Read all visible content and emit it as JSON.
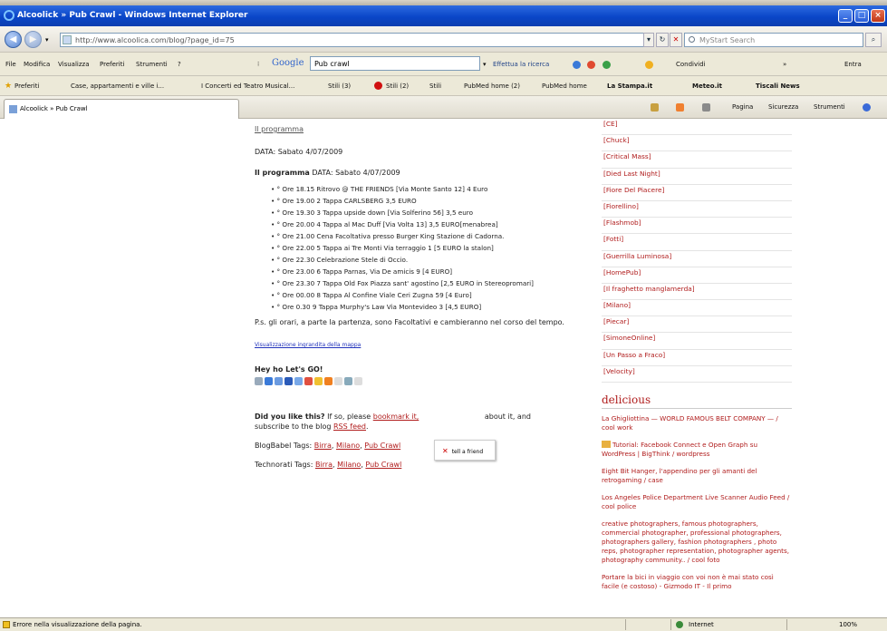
{
  "window": {
    "title": "Alcoolick » Pub Crawl - Windows Internet Explorer"
  },
  "nav": {
    "address": "http://www.alcoolica.com/blog/?page_id=75",
    "search_placeholder": "MyStart Search"
  },
  "menu": {
    "items": [
      "File",
      "Modifica",
      "Visualizza",
      "Preferiti",
      "Strumenti",
      "?"
    ],
    "google_query": "Pub crawl",
    "toolbar_items": [
      "Effettua la ricerca",
      "Condividi",
      "Entra"
    ]
  },
  "favorites": {
    "label": "Preferiti",
    "items": [
      "Case, appartamenti e ville i...",
      "I Concerti ed Teatro Musical...",
      "Stili (3)",
      "Stili (2)",
      "Stili",
      "PubMed home (2)",
      "PubMed home",
      "La Stampa.it",
      "Meteo.it",
      "Tiscali News"
    ]
  },
  "tab": {
    "title": "Alcoolick » Pub Crawl",
    "tools": [
      "Pagina",
      "Sicurezza",
      "Strumenti"
    ]
  },
  "main": {
    "section_title": "Il programma",
    "date_line": "DATA: Sabato 4/07/2009",
    "program_heading": "Il programma",
    "program_date": "DATA: Sabato 4/07/2009",
    "items": [
      "° Ore 18.15 Ritrovo @ THE FRIENDS [Via Monte Santo 12] 4 Euro",
      "° Ore 19.00 2 Tappa CARLSBERG 3,5 EURO",
      "° Ore 19.30 3 Tappa upside down [Via Solferino 56] 3,5 euro",
      "° Ore 20.00 4 Tappa al Mac Duff [Via Volta 13] 3,5 EURO[menabrea]",
      "° Ore 21.00 Cena Facoltativa presso Burger King Stazione di Cadorna.",
      "° Ore 22.00 5 Tappa ai Tre Monti Via terraggio 1 [5 EURO la stalon]",
      "° Ore 22.30 Celebrazione Stele di Occio.",
      "° Ore 23.00 6 Tappa Parnas, Via De amicis 9 [4 EURO]",
      "° Ore 23.30 7 Tappa Old Fox Piazza sant' agostino [2,5 EURO in Stereopromari]",
      "° Ore 00.00 8 Tappa Al Confine Viale Ceri Zugna 59 [4 Euro]",
      "° Ore 0.30 9 Tappa Murphy's Law Via Montevideo 3 [4,5 EURO]"
    ],
    "note": "P.s. gli orari, a parte la partenza, sono Facoltativi e cambieranno nel corso del tempo.",
    "map_link": "Visualizzazione ingrandita della mappa",
    "share_title": "Hey ho Let's GO!",
    "like_prefix": "Did you like this?",
    "like_mid1": " If so, please ",
    "bookmark_link": "bookmark it,",
    "tell_friend": "tell a friend",
    "like_mid2": " about it, and subscribe to the blog ",
    "rss_link": "RSS feed",
    "like_end": ".",
    "bloglines_label": "BlogBabel Tags: ",
    "technorati_label": "Technorati Tags: ",
    "tags": [
      "Birra",
      "Milano",
      "Pub Crawl"
    ]
  },
  "sidebar": {
    "tags": [
      "[CE]",
      "[Chuck]",
      "[Critical Mass]",
      "[Died Last Night]",
      "[Fiore Del Piacere]",
      "[Fiorellino]",
      "[Flashmob]",
      "[Fotti]",
      "[Guerrilla Luminosa]",
      "[HomePub]",
      "[Il fraghetto manglamerda]",
      "[Milano]",
      "[Piecar]",
      "[SimoneOnline]",
      "[Un Passo a Fraco]",
      "[Velocity]"
    ],
    "delicious_title": "delicious",
    "delicious": [
      "La Ghigliottina — WORLD FAMOUS BELT COMPANY — / cool work",
      "Tutorial: Facebook Connect e Open Graph su WordPress | BigThink / wordpress",
      "Eight Bit Hanger, l'appendino per gli amanti del retrogaming / case",
      "Los Angeles Police Department Live Scanner Audio Feed / cool police",
      "creative photographers, famous photographers, commercial photographer, professional photographers, photographers gallery, fashion photographers , photo reps, photographer representation, photographer agents, photography community.. / cool foto",
      "Portare la bici in viaggio con voi non è mai stato così facile (e costoso) - Gizmodo IT - Il primo"
    ]
  },
  "status": {
    "text": "Errore nella visualizzazione della pagina.",
    "zone": "Internet",
    "zoom": "100%"
  }
}
